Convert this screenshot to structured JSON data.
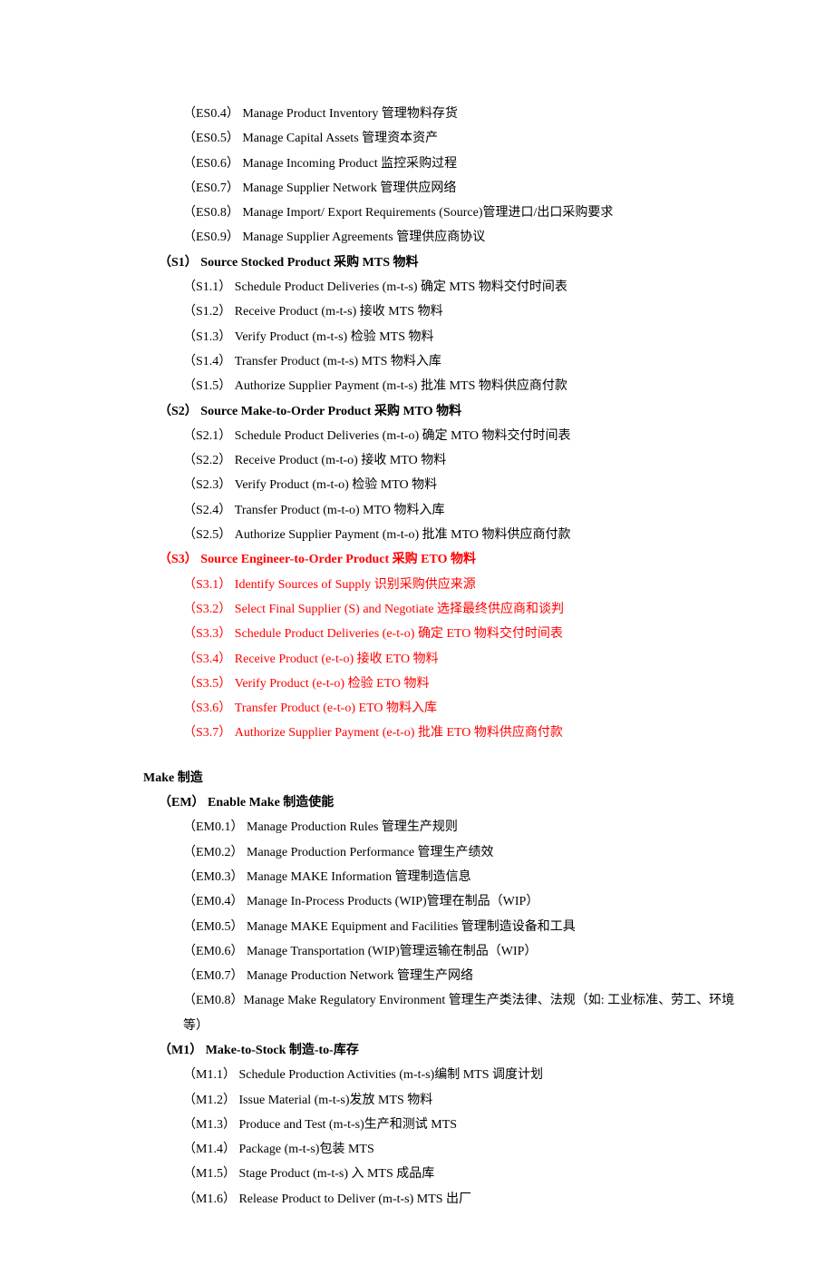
{
  "source_es": [
    "（ES0.4） Manage Product Inventory 管理物料存货",
    "（ES0.5） Manage Capital Assets 管理资本资产",
    "（ES0.6） Manage Incoming Product 监控采购过程",
    "（ES0.7） Manage Supplier Network 管理供应网络",
    "（ES0.8） Manage Import/ Export Requirements (Source)管理进口/出口采购要求",
    "（ES0.9） Manage Supplier Agreements 管理供应商协议"
  ],
  "s1": {
    "heading": "（S1） Source Stocked Product  采购 MTS 物料",
    "items": [
      "（S1.1） Schedule Product Deliveries (m-t-s)  确定 MTS 物料交付时间表",
      "（S1.2） Receive Product (m-t-s)  接收 MTS 物料",
      "（S1.3） Verify Product (m-t-s)  检验 MTS 物料",
      "（S1.4） Transfer Product (m-t-s)    MTS 物料入库",
      "（S1.5） Authorize Supplier Payment (m-t-s)  批准 MTS 物料供应商付款"
    ]
  },
  "s2": {
    "heading": "（S2） Source Make-to-Order Product  采购 MTO 物料",
    "items": [
      "（S2.1） Schedule Product Deliveries (m-t-o)  确定 MTO 物料交付时间表",
      "（S2.2） Receive Product (m-t-o)  接收 MTO 物料",
      "（S2.3） Verify Product (m-t-o)  检验 MTO 物料",
      "（S2.4） Transfer Product (m-t-o) MTO 物料入库",
      "（S2.5） Authorize Supplier Payment (m-t-o)  批准 MTO 物料供应商付款"
    ]
  },
  "s3": {
    "heading": "（S3） Source Engineer-to-Order Product  采购 ETO 物料",
    "items": [
      "（S3.1） Identify Sources of Supply 识别采购供应来源",
      "（S3.2） Select Final Supplier (S) and Negotiate 选择最终供应商和谈判",
      "（S3.3） Schedule Product Deliveries (e-t-o)  确定 ETO 物料交付时间表",
      "（S3.4） Receive Product (e-t-o)  接收 ETO 物料",
      "（S3.5） Verify Product (e-t-o)  检验 ETO 物料",
      "（S3.6） Transfer Product (e-t-o)    ETO 物料入库",
      "（S3.7） Authorize Supplier Payment (e-t-o)  批准 ETO 物料供应商付款"
    ]
  },
  "make_heading": "Make 制造",
  "em": {
    "heading": "（EM） Enable Make 制造使能",
    "items": [
      "（EM0.1） Manage Production Rules 管理生产规则",
      "（EM0.2） Manage Production Performance 管理生产绩效",
      "（EM0.3） Manage MAKE Information 管理制造信息",
      "（EM0.4） Manage In-Process Products (WIP)管理在制品（WIP）",
      "（EM0.5） Manage MAKE Equipment and Facilities 管理制造设备和工具",
      "（EM0.6） Manage Transportation (WIP)管理运输在制品（WIP）",
      "（EM0.7） Manage Production Network 管理生产网络",
      "（EM0.8）Manage Make Regulatory Environment 管理生产类法律、法规（如: 工业标准、劳工、环境等）"
    ]
  },
  "m1": {
    "heading": "（M1） Make-to-Stock  制造-to-库存",
    "items": [
      "（M1.1） Schedule Production Activities (m-t-s)编制 MTS 调度计划",
      "（M1.2） Issue Material (m-t-s)发放 MTS 物料",
      "（M1.3） Produce and Test (m-t-s)生产和测试 MTS",
      "（M1.4） Package (m-t-s)包装 MTS",
      "（M1.5） Stage Product (m-t-s)  入 MTS 成品库",
      "（M1.6） Release Product to Deliver (m-t-s) MTS 出厂"
    ]
  }
}
